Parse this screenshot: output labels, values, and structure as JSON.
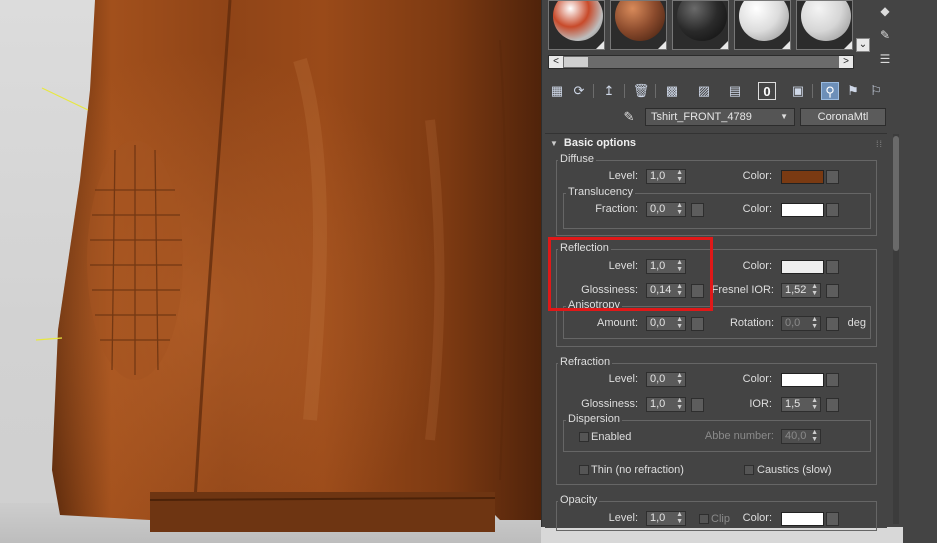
{
  "viewport": {
    "description_label": ""
  },
  "panel": {
    "material_slots": [
      {
        "name": "slot-1",
        "color": "#cfcfcf"
      },
      {
        "name": "slot-2",
        "color": "#8a4a2c"
      },
      {
        "name": "slot-3",
        "color": "#2a2a2a"
      },
      {
        "name": "slot-4",
        "color": "#dcdcdc"
      },
      {
        "name": "slot-5",
        "color": "#d6d6d6"
      }
    ],
    "scroll_down_glyph": "⌄",
    "scroll_left_glyph": "<",
    "scroll_right_glyph": ">",
    "side_icons": [
      "◆",
      "✎",
      "☰"
    ],
    "toolbar_icons": [
      "▦",
      "⟳",
      "↥",
      "🗑",
      "▩",
      "▨",
      "▤",
      "0",
      "▣",
      "⚲",
      "⚑",
      "⚐"
    ],
    "material_name": "Tshirt_FRONT_4789",
    "material_type": "CoronaMtl",
    "rollout_title": "Basic options",
    "rollout_dots": "⁞⁞"
  },
  "diffuse": {
    "title": "Diffuse",
    "level_label": "Level:",
    "level_value": "1,0",
    "color_label": "Color:",
    "color": "#7a3a12",
    "translucency": {
      "title": "Translucency",
      "fraction_label": "Fraction:",
      "fraction_value": "0,0",
      "color_label": "Color:",
      "color": "#ffffff"
    }
  },
  "reflection": {
    "title": "Reflection",
    "level_label": "Level:",
    "level_value": "1,0",
    "color_label": "Color:",
    "color": "#eeeeee",
    "glossiness_label": "Glossiness:",
    "glossiness_value": "0,14",
    "fresnel_label": "Fresnel IOR:",
    "fresnel_value": "1,52",
    "anisotropy": {
      "title": "Anisotropy",
      "amount_label": "Amount:",
      "amount_value": "0,0",
      "rotation_label": "Rotation:",
      "rotation_value": "0,0",
      "rotation_unit": "deg"
    }
  },
  "refraction": {
    "title": "Refraction",
    "level_label": "Level:",
    "level_value": "0,0",
    "color_label": "Color:",
    "color": "#ffffff",
    "glossiness_label": "Glossiness:",
    "glossiness_value": "1,0",
    "ior_label": "IOR:",
    "ior_value": "1,5",
    "dispersion": {
      "title": "Dispersion",
      "enabled_label": "Enabled",
      "abbe_label": "Abbe number:",
      "abbe_value": "40,0"
    },
    "thin_label": "Thin (no refraction)",
    "caustics_label": "Caustics (slow)"
  },
  "opacity": {
    "title": "Opacity",
    "level_label": "Level:",
    "level_value": "1,0",
    "clip_label": "Clip",
    "color_label": "Color:",
    "color": "#ffffff"
  },
  "colors": {
    "panel_bg": "#444444",
    "highlight": "#e01818",
    "jacket": "#8e4216"
  }
}
